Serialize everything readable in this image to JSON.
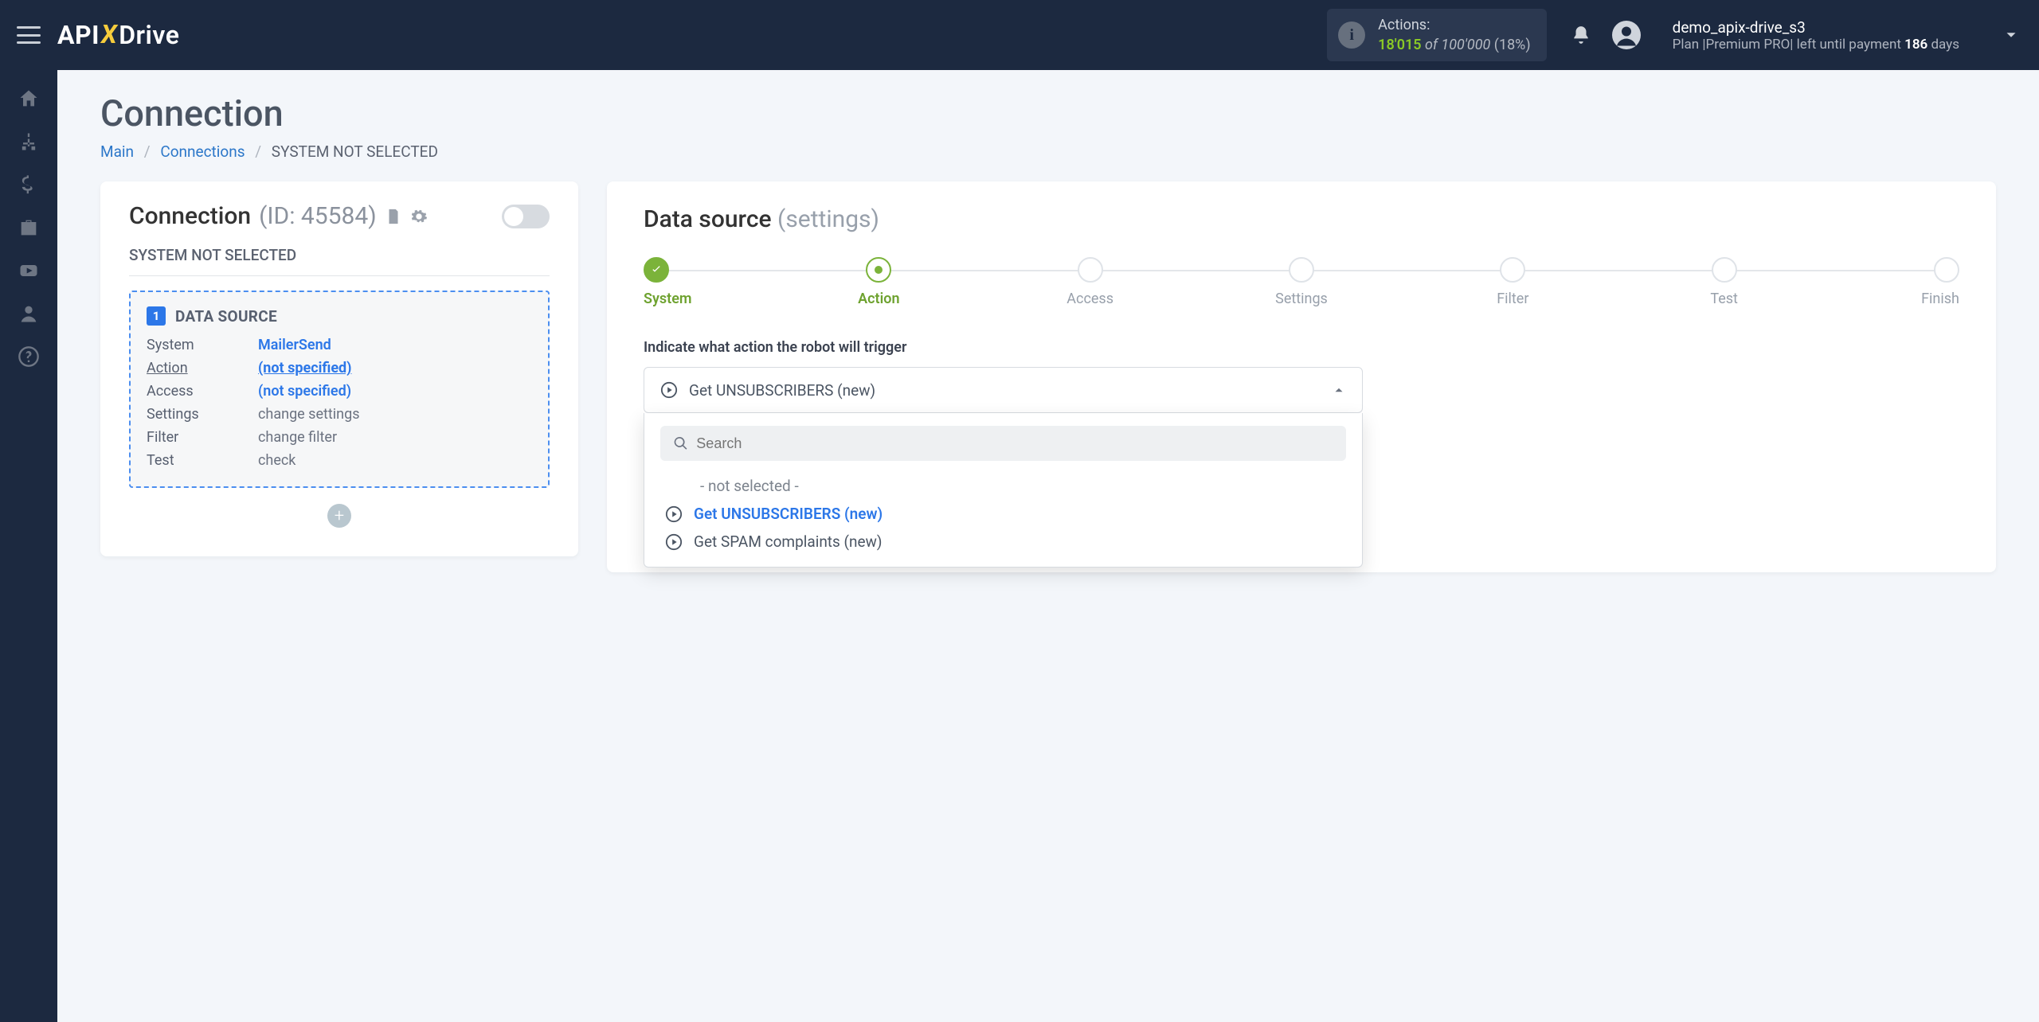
{
  "topbar": {
    "actions_label": "Actions:",
    "actions_used": "18'015",
    "actions_of": " of ",
    "actions_total": "100'000",
    "actions_pct": " (18%)",
    "username": "demo_apix-drive_s3",
    "plan_prefix": "Plan |",
    "plan_name": "Premium PRO",
    "plan_mid": "| left until payment ",
    "plan_days": "186",
    "plan_suffix": " days"
  },
  "page": {
    "title": "Connection",
    "crumb_main": "Main",
    "crumb_conn": "Connections",
    "crumb_current": "SYSTEM NOT SELECTED"
  },
  "left": {
    "conn_label": "Connection ",
    "conn_id": "(ID: 45584)",
    "system_not_sel": "SYSTEM NOT SELECTED",
    "ds_num": "1",
    "ds_title": "DATA SOURCE",
    "rows": {
      "system_k": "System",
      "system_v": "MailerSend",
      "action_k": "Action",
      "action_v": "(not specified)",
      "access_k": "Access",
      "access_v": "(not specified)",
      "settings_k": "Settings",
      "settings_v": "change settings",
      "filter_k": "Filter",
      "filter_v": "change filter",
      "test_k": "Test",
      "test_v": "check"
    }
  },
  "right": {
    "heading": "Data source ",
    "heading_sub": "(settings)",
    "steps": [
      "System",
      "Action",
      "Access",
      "Settings",
      "Filter",
      "Test",
      "Finish"
    ],
    "field_label": "Indicate what action the robot will trigger",
    "selected": "Get UNSUBSCRIBERS (new)",
    "search_placeholder": "Search",
    "options": {
      "none": "- not selected -",
      "o1": "Get UNSUBSCRIBERS (new)",
      "o2": "Get SPAM complaints (new)"
    }
  }
}
